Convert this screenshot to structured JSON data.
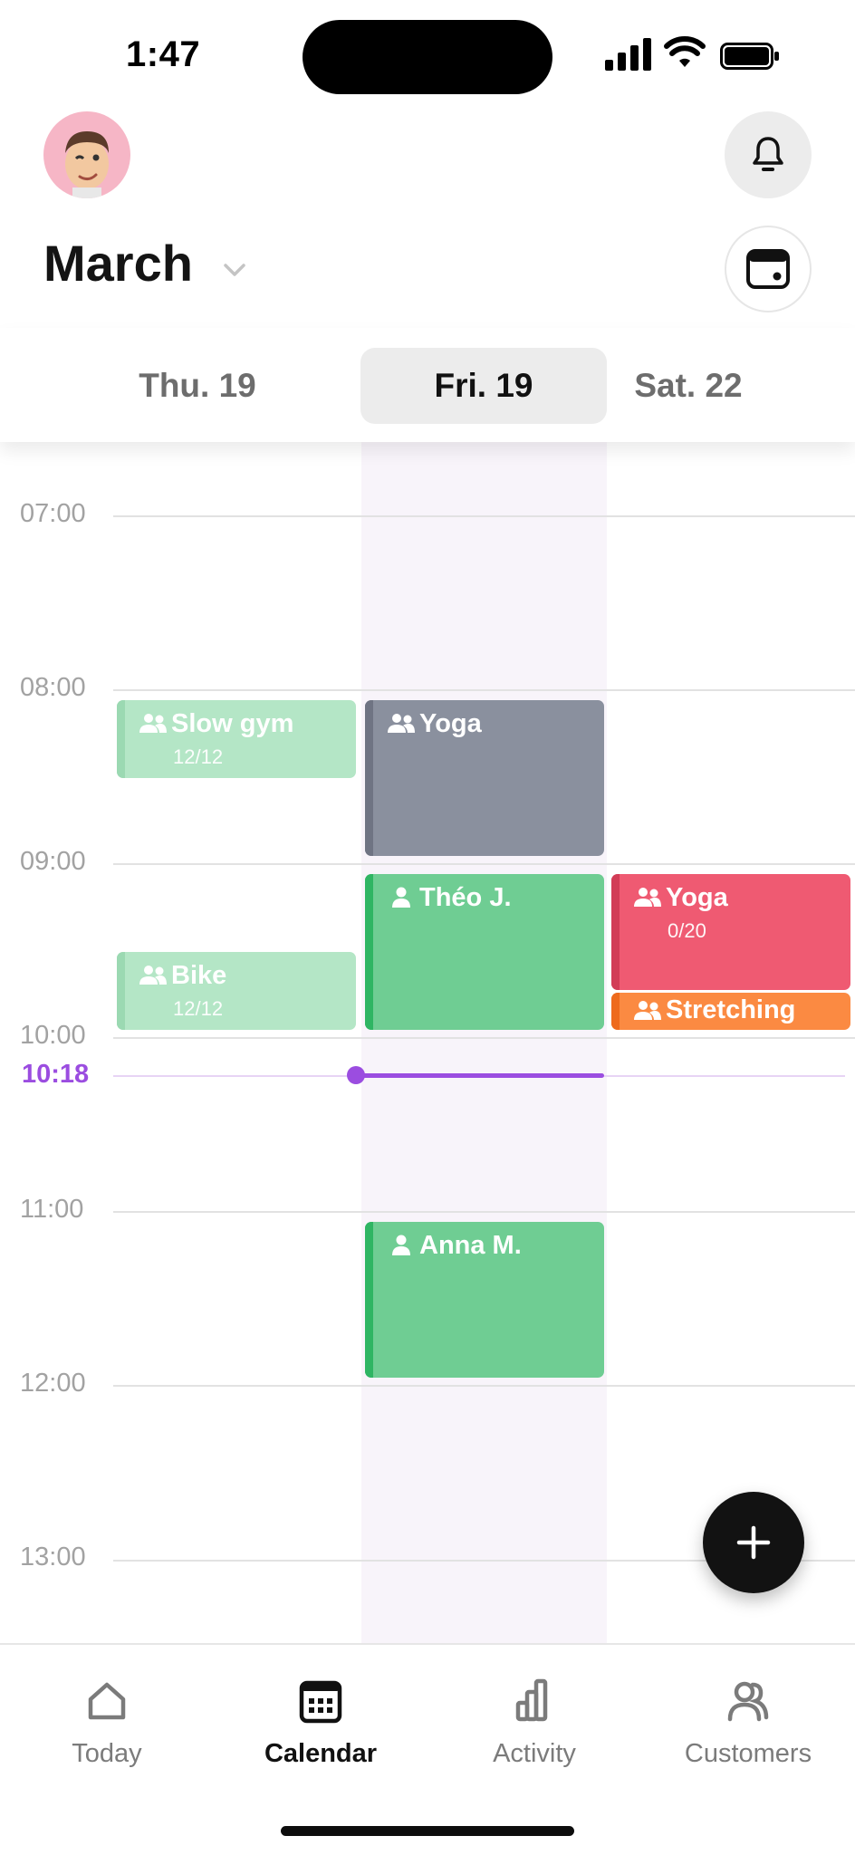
{
  "status_bar": {
    "time": "1:47"
  },
  "header": {
    "month": "March"
  },
  "day_tabs": [
    {
      "label": "Thu. 19",
      "selected": false
    },
    {
      "label": "Fri. 19",
      "selected": true
    },
    {
      "label": "Sat. 22",
      "selected": false
    }
  ],
  "timeline": {
    "hours": [
      "07:00",
      "08:00",
      "09:00",
      "10:00",
      "11:00",
      "12:00",
      "13:00"
    ],
    "now": "10:18"
  },
  "events": [
    {
      "title": "Slow gym",
      "sub": "12/12",
      "type": "group",
      "day": "Thu. 19"
    },
    {
      "title": "Bike",
      "sub": "12/12",
      "type": "group",
      "day": "Thu. 19"
    },
    {
      "title": "Yoga",
      "sub": "",
      "type": "group",
      "day": "Fri. 19"
    },
    {
      "title": "Théo J.",
      "sub": "",
      "type": "single",
      "day": "Fri. 19"
    },
    {
      "title": "Anna M.",
      "sub": "",
      "type": "single",
      "day": "Fri. 19"
    },
    {
      "title": "Yoga",
      "sub": "0/20",
      "type": "group",
      "day": "Sat. 22"
    },
    {
      "title": "Stretching",
      "sub": "",
      "type": "group",
      "day": "Sat. 22"
    }
  ],
  "colors": {
    "accent_now": "#9b4de0",
    "green_light": "#b4e6c6",
    "green": "#6fcd93",
    "gray": "#8a909e",
    "red": "#ef5a72",
    "orange": "#fb8a42"
  },
  "tabbar": {
    "items": [
      {
        "label": "Today",
        "icon": "home-icon",
        "active": false
      },
      {
        "label": "Calendar",
        "icon": "calendar-icon",
        "active": true
      },
      {
        "label": "Activity",
        "icon": "bar-chart-icon",
        "active": false
      },
      {
        "label": "Customers",
        "icon": "customers-icon",
        "active": false
      }
    ]
  }
}
